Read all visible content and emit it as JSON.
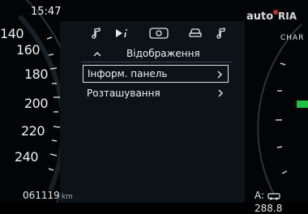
{
  "time": "15:47",
  "speedo": {
    "ticks": [
      "140",
      "160",
      "180",
      "200",
      "220",
      "240"
    ]
  },
  "odometer": {
    "value": "061119",
    "unit": "km"
  },
  "range": {
    "prefix": "A:",
    "value": "288.8"
  },
  "right_gauge": {
    "label": "CHAR"
  },
  "menu": {
    "tabs": [
      {
        "icon": "music-note-icon"
      },
      {
        "icon": "play-info-icon"
      },
      {
        "icon": "camera-icon"
      },
      {
        "icon": "car-icon"
      },
      {
        "icon": "music-note-icon"
      }
    ],
    "header_title": "Відображення",
    "items": [
      {
        "label": "Інформ. панель",
        "selected": true
      },
      {
        "label": "Розташування",
        "selected": false
      }
    ]
  },
  "watermark": {
    "text": "auto",
    "brand": "RIA"
  },
  "colors": {
    "accent_green": "#20c040",
    "panel_bg": "#0b1218",
    "divider": "#3b4650"
  }
}
